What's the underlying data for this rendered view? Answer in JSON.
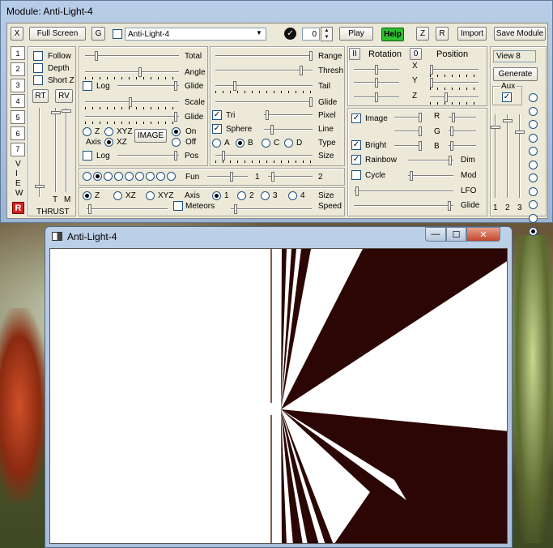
{
  "module": {
    "title": "Module: Anti-Light-4",
    "toolbar": {
      "x_label": "X",
      "fullscreen_label": "Full Screen",
      "g_label": "G",
      "module_select": "Anti-Light-4",
      "counter_value": "0",
      "play_label": "Play",
      "help_label": "Help",
      "z_label": "Z",
      "r_label": "R",
      "import_label": "Import",
      "save_label": "Save Module"
    },
    "view_tabs": [
      "1",
      "2",
      "3",
      "4",
      "5",
      "6",
      "7"
    ],
    "view_letters": [
      "V",
      "I",
      "E",
      "W"
    ],
    "left": {
      "follow": "Follow",
      "depth": "Depth",
      "shortz": "Short Z",
      "rt": "RT",
      "rv": "RV",
      "t": "T",
      "m": "M",
      "thrust": "THRUST",
      "r_logo": "R"
    },
    "col1": {
      "total": "Total",
      "angle": "Angle",
      "log1": "Log",
      "glide1": "Glide",
      "scale": "Scale",
      "glide2": "Glide",
      "z": "Z",
      "xyz": "XYZ",
      "axis": "Axis",
      "xz": "XZ",
      "image_btn": "IMAGE",
      "on": "On",
      "off": "Off",
      "log2": "Log",
      "pos": "Pos"
    },
    "col2": {
      "range": "Range",
      "thresh": "Thresh",
      "tail": "Tail",
      "glide": "Glide",
      "tri": "Tri",
      "pixel": "Pixel",
      "sphere": "Sphere",
      "line": "Line",
      "a": "A",
      "b": "B",
      "c": "C",
      "d": "D",
      "type": "Type",
      "size": "Size"
    },
    "fun_row": {
      "fun": "Fun",
      "one": "1",
      "two": "2"
    },
    "axis_row": {
      "z": "Z",
      "xz": "XZ",
      "xyz": "XYZ",
      "axis": "Axis",
      "n1": "1",
      "n2": "2",
      "n3": "3",
      "n4": "4",
      "size": "Size",
      "meteors": "Meteors",
      "speed": "Speed"
    },
    "rot": {
      "pause": "II",
      "rotation": "Rotation",
      "zero": "0",
      "position": "Position",
      "x": "X",
      "y": "Y",
      "z": "Z"
    },
    "color": {
      "image": "Image",
      "r": "R",
      "g": "G",
      "bright": "Bright",
      "b": "B",
      "rainbow": "Rainbow",
      "dim": "Dim",
      "cycle": "Cycle",
      "mod": "Mod",
      "lfo": "LFO",
      "glide": "Glide"
    },
    "view_panel": {
      "view_name": "View 8",
      "generate": "Generate",
      "aux": "Aux",
      "n1": "1",
      "n2": "2",
      "n3": "3"
    }
  },
  "window": {
    "title": "Anti-Light-4",
    "minimize": "—",
    "maximize": "☐",
    "close": "✕"
  },
  "colors": {
    "help_green": "#2ec02e",
    "panel": "#ece9d8",
    "ray_dark": "#2c0604",
    "r_logo": "#d62020"
  }
}
